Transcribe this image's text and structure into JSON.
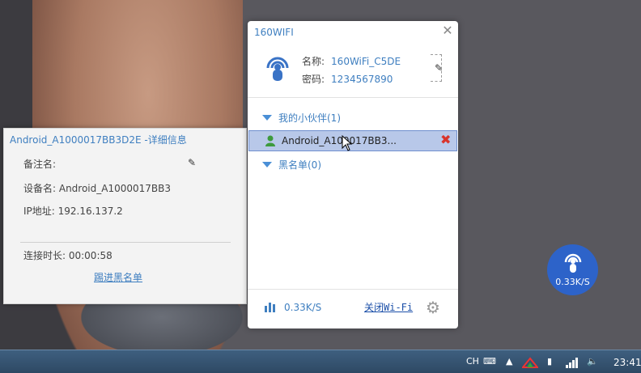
{
  "detail_panel": {
    "title": "Android_A1000017BB3D2E  -详细信息",
    "remark_label": "备注名:",
    "device_name": "设备名: Android_A1000017BB3",
    "ip": "IP地址: 192.16.137.2",
    "duration": "连接时长: 00:00:58",
    "blacklist_link": "踢进黑名单"
  },
  "wifi_window": {
    "app_title": "160WIFI",
    "name_label": "名称:",
    "name_value": "160WiFi_C5DE",
    "password_label": "密码:",
    "password_value": "1234567890",
    "group_friends": "我的小伙伴(1)",
    "device_name": "Android_A100017BB3...",
    "group_blacklist": "黑名单(0)",
    "speed": "0.33K/S",
    "close_wifi": "关闭Wi-Fi"
  },
  "float_widget": {
    "speed": "0.33K/S"
  },
  "taskbar": {
    "lang": "CH",
    "time": "23:41"
  },
  "colors": {
    "accent": "#3f7fc0",
    "selected_row": "#b8c8e9",
    "float_widget": "#2d63c9",
    "delete": "#d9342b"
  },
  "icons": [
    "wifi-logo-icon",
    "edit-icon",
    "close-icon",
    "triangle-down-icon",
    "person-icon",
    "delete-icon",
    "speed-bars-icon",
    "gear-icon",
    "cursor-icon",
    "keyboard-icon",
    "network-icon",
    "volume-icon"
  ]
}
